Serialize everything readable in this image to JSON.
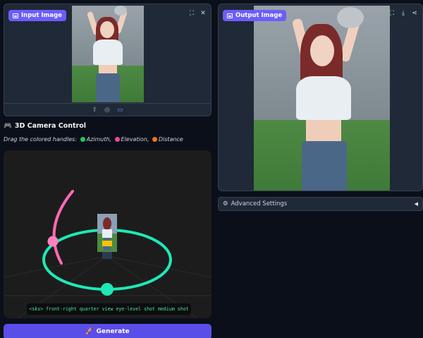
{
  "input_panel": {
    "badge_label": "Input Image",
    "toolbar_icons": [
      "fullscreen-icon",
      "close-icon"
    ],
    "footer_icons": [
      "upload-icon",
      "webcam-icon",
      "clipboard-icon"
    ]
  },
  "output_panel": {
    "badge_label": "Output Image",
    "toolbar_icons": [
      "fullscreen-icon",
      "download-icon",
      "share-icon"
    ]
  },
  "camera_control": {
    "emoji": "🎮",
    "title": "3D Camera Control",
    "hint_prefix": "Drag the colored handles:",
    "handles": [
      {
        "label": "Azimuth,",
        "color": "#22c55e"
      },
      {
        "label": "Elevation,",
        "color": "#ec4899"
      },
      {
        "label": "Distance",
        "color": "#f97316"
      }
    ],
    "prompt_text": "<sks> front-right quarter view eye-level shot medium shot",
    "colors": {
      "ring": "#1de9b6",
      "arc": "#ff69b4",
      "handle_azimuth": "#1de9b6",
      "handle_elevation": "#ff80c0"
    }
  },
  "advanced_settings": {
    "icon": "⚙",
    "label": "Advanced Settings",
    "arrow": "◀"
  },
  "generate_button": {
    "emoji": "🚀",
    "label": "Generate"
  }
}
